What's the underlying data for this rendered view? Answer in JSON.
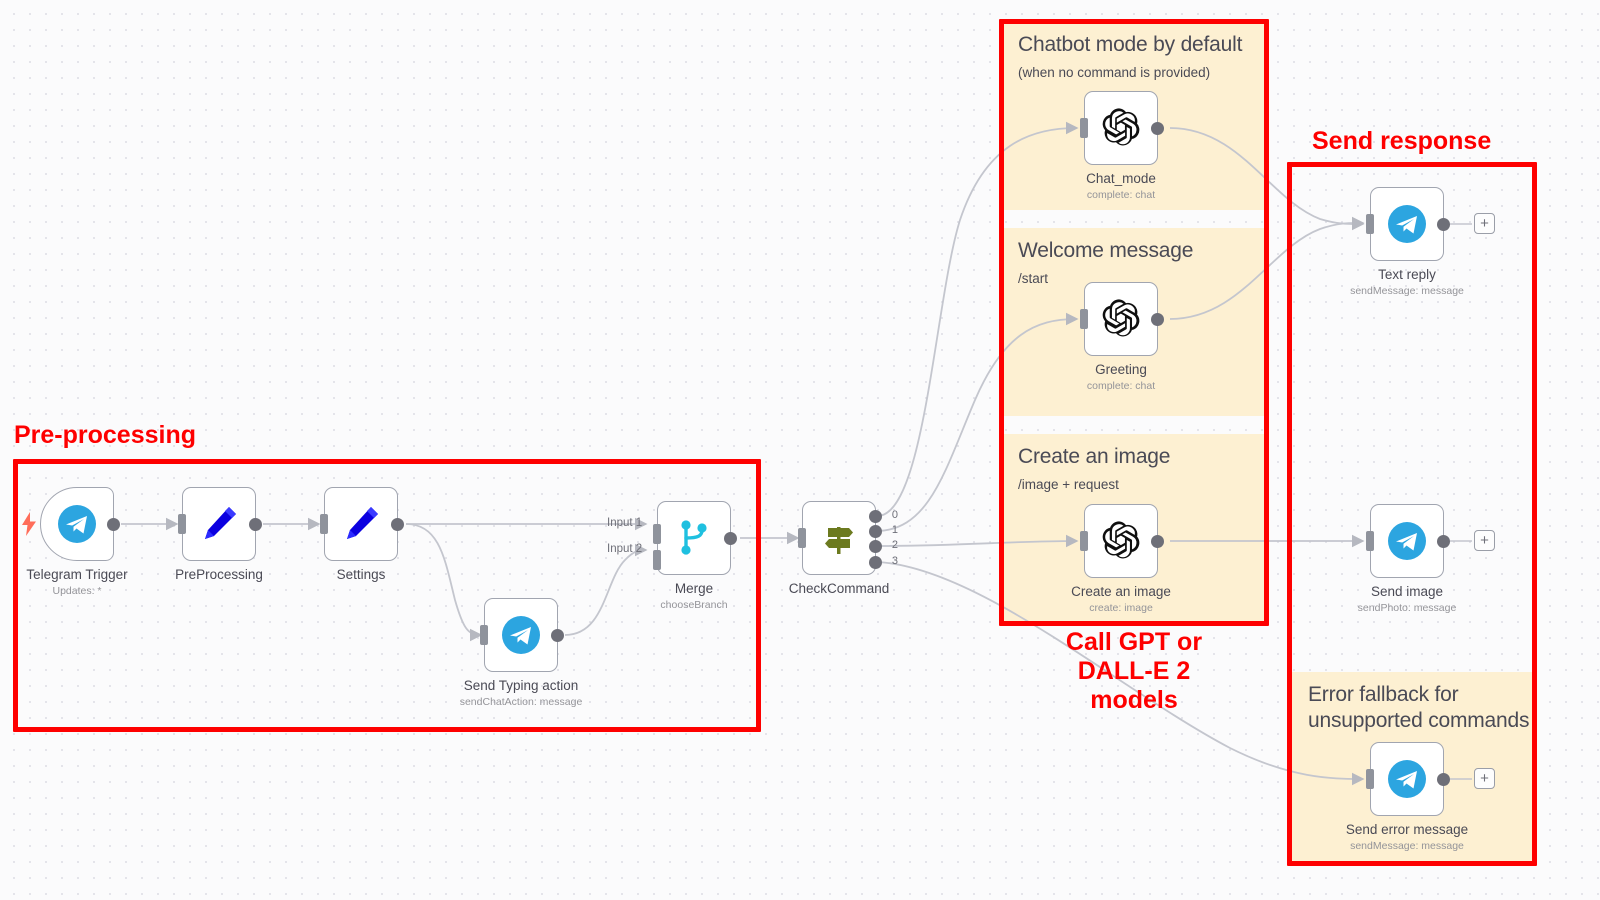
{
  "app": {
    "canvas_name": "n8n-workflow-canvas",
    "background": "#fbfbfc",
    "accent_red": "#fe0000",
    "sticky_color": "#fdf0d2",
    "telegram_blue": "#2ca5e0",
    "node_border": "#a1a5b0",
    "connector_gray": "#6e6f78"
  },
  "annotations": [
    {
      "id": "pre-processing",
      "label": "Pre-processing"
    },
    {
      "id": "call-models",
      "label": "Call GPT or\nDALL-E 2\nmodels",
      "line1": "Call GPT or",
      "line2": "DALL-E 2",
      "line3": "models"
    },
    {
      "id": "send-response",
      "label": "Send response"
    }
  ],
  "sticky_notes": [
    {
      "id": "chatbot-mode",
      "title": "Chatbot mode by default",
      "subtitle": "(when no command is provided)"
    },
    {
      "id": "welcome-message",
      "title": "Welcome message",
      "subtitle": "/start"
    },
    {
      "id": "create-an-image",
      "title": "Create an image",
      "subtitle": "/image + request"
    },
    {
      "id": "error-fallback",
      "title_line1": "Error fallback for",
      "title_line2": "unsupported commands",
      "subtitle": ""
    }
  ],
  "nodes": {
    "telegram_trigger": {
      "label": "Telegram Trigger",
      "sublabel": "Updates: *",
      "icon": "telegram-icon"
    },
    "preprocessing": {
      "label": "PreProcessing",
      "sublabel": "",
      "icon": "pencil-icon"
    },
    "settings": {
      "label": "Settings",
      "sublabel": "",
      "icon": "pencil-icon"
    },
    "send_typing": {
      "label": "Send Typing action",
      "sublabel": "sendChatAction: message",
      "icon": "telegram-icon"
    },
    "merge": {
      "label": "Merge",
      "sublabel": "chooseBranch",
      "icon": "merge-icon",
      "input_labels": [
        "Input 1",
        "Input 2"
      ]
    },
    "check_command": {
      "label": "CheckCommand",
      "sublabel": "",
      "icon": "switch-icon",
      "outputs": [
        "0",
        "1",
        "2",
        "3"
      ]
    },
    "chat_mode": {
      "label": "Chat_mode",
      "sublabel": "complete: chat",
      "icon": "openai-icon"
    },
    "greeting": {
      "label": "Greeting",
      "sublabel": "complete: chat",
      "icon": "openai-icon"
    },
    "create_image": {
      "label": "Create an image",
      "sublabel": "create: image",
      "icon": "openai-icon"
    },
    "text_reply": {
      "label": "Text reply",
      "sublabel": "sendMessage: message",
      "icon": "telegram-icon"
    },
    "send_image": {
      "label": "Send image",
      "sublabel": "sendPhoto: message",
      "icon": "telegram-icon"
    },
    "send_error": {
      "label": "Send error message",
      "sublabel": "sendMessage: message",
      "icon": "telegram-icon"
    }
  },
  "buttons": {
    "add_plus": "+"
  }
}
